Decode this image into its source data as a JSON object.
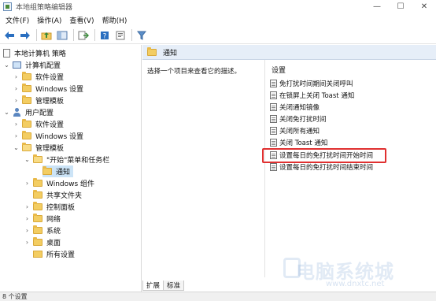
{
  "window": {
    "title": "本地组策略编辑器",
    "controls": {
      "minimize": "—",
      "maximize": "☐",
      "close": "✕"
    }
  },
  "menubar": {
    "items": [
      "文件(F)",
      "操作(A)",
      "查看(V)",
      "帮助(H)"
    ]
  },
  "toolbar": {
    "buttons": [
      "back-arrow-icon",
      "forward-arrow-icon",
      "up-folder-icon",
      "show-tree-icon",
      "export-list-icon",
      "help-icon",
      "properties-icon",
      "filter-icon"
    ]
  },
  "tree": {
    "items": [
      {
        "label": "本地计算机 策略",
        "icon": "doc-icon"
      },
      {
        "label": "计算机配置",
        "icon": "pc-icon",
        "expanded": true
      },
      {
        "label": "软件设置",
        "icon": "folder-icon"
      },
      {
        "label": "Windows 设置",
        "icon": "folder-icon"
      },
      {
        "label": "管理模板",
        "icon": "folder-icon"
      },
      {
        "label": "用户配置",
        "icon": "user-icon",
        "expanded": true
      },
      {
        "label": "软件设置",
        "icon": "folder-icon"
      },
      {
        "label": "Windows 设置",
        "icon": "folder-icon"
      },
      {
        "label": "管理模板",
        "icon": "folder-icon",
        "expanded": true
      },
      {
        "label": "\"开始\"菜单和任务栏",
        "icon": "folder-open-icon",
        "expanded": true
      },
      {
        "label": "通知",
        "icon": "folder-icon",
        "selected": true
      },
      {
        "label": "Windows 组件",
        "icon": "folder-icon"
      },
      {
        "label": "共享文件夹",
        "icon": "folder-icon"
      },
      {
        "label": "控制面板",
        "icon": "folder-icon"
      },
      {
        "label": "网络",
        "icon": "folder-icon"
      },
      {
        "label": "系统",
        "icon": "folder-icon"
      },
      {
        "label": "桌面",
        "icon": "folder-icon"
      },
      {
        "label": "所有设置",
        "icon": "settings-folder-icon"
      }
    ]
  },
  "right_pane": {
    "header_title": "通知",
    "description": "选择一个项目来查看它的描述。",
    "settings_header": "设置",
    "settings": [
      "免打扰时间期间关闭呼叫",
      "在锁屏上关闭 Toast 通知",
      "关闭通知镜像",
      "关闭免打扰时间",
      "关闭所有通知",
      "关闭 Toast 通知",
      "设置每日的免打扰时间开始时间",
      "设置每日的免打扰时间结束时间"
    ],
    "highlighted_setting": "设置每日的免打扰时间开始时间"
  },
  "tabs": [
    "扩展",
    "标准"
  ],
  "status": "8 个设置",
  "watermark": {
    "text": "电脑系统城",
    "url": "www.dnxtc.net"
  },
  "colors": {
    "header_bg": "#e6eef8",
    "selected_bg": "#cce4f7",
    "highlight_border": "#e03030",
    "folder_yellow": "#f3cd62"
  }
}
